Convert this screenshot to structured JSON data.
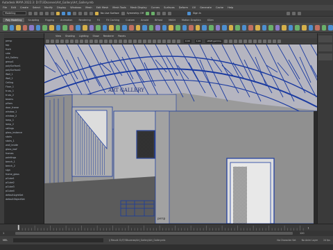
{
  "window": {
    "title": "Autodesk MAYA 2022.3: D:\\T\\3Dscenes\\Art_Gallery\\Art_Gallery.mb"
  },
  "menus": [
    "File",
    "Edit",
    "Create",
    "Select",
    "Modify",
    "Display",
    "Windows",
    "Mesh",
    "Edit Mesh",
    "Mesh Tools",
    "Mesh Display",
    "Curves",
    "Surfaces",
    "Deform",
    "UV",
    "Generate",
    "Cache",
    "Help"
  ],
  "status": {
    "mode": "Modeling",
    "live_surface": "No Live Surface",
    "symmetry": "Symmetry: Off",
    "sign_in": "Sign In"
  },
  "shelf": {
    "tabs": [
      "Poly Modeling",
      "Sculpting",
      "Rigging",
      "Animation",
      "Rendering",
      "FX",
      "FX Caching",
      "Custom",
      "Arnold",
      "Bifrost",
      "MASH",
      "Motion Graphics",
      "XGen"
    ],
    "active_tab": "Poly Modeling",
    "icon_colors": [
      "#6ab06a",
      "#4d8fd0",
      "#d6b04a",
      "#c07060",
      "#8a7ac8",
      "#4d8fd0",
      "#6ab06a",
      "#d6b04a",
      "#4d8fd0",
      "#6ab06a",
      "#c07060",
      "#4d8fd0",
      "#d6b04a",
      "#8a7ac8",
      "#6ab06a",
      "#4d8fd0",
      "#d6b04a",
      "#6ab06a",
      "#4d8fd0",
      "#c07060",
      "#d6b04a",
      "#4d8fd0",
      "#6ab06a",
      "#8a7ac8",
      "#4d8fd0",
      "#d6b04a",
      "#6ab06a",
      "#4d8fd0",
      "#c07060",
      "#d6b04a",
      "#4d8fd0",
      "#6ab06a",
      "#8a7ac8",
      "#4d8fd0",
      "#d6b04a",
      "#6ab06a",
      "#4d8fd0",
      "#c07060",
      "#d6b04a",
      "#4d8fd0",
      "#6ab06a",
      "#8a7ac8",
      "#d6b04a",
      "#4d8fd0",
      "#6ab06a",
      "#d6b04a",
      "#4d8fd0",
      "#c07060",
      "#6ab06a",
      "#4d8fd0"
    ]
  },
  "outliner": {
    "items": [
      "persp",
      "top",
      "front",
      "side",
      "Art_Gallery",
      "group1",
      "polySurface1",
      "polySurface2",
      "Wall_1",
      "Wall_2",
      "Ceiling",
      "Floor_1",
      "truss_1",
      "truss_2",
      "beams",
      "pillars",
      "door_frame",
      "window_1",
      "window_2",
      "lamp_1",
      "lamp_2",
      "railings",
      "glass_instance",
      "stairs",
      "stairs_1",
      "wall_inside",
      "glass_roof",
      "frames",
      "paintings",
      "bench_1",
      "bench_2",
      "sign",
      "frame_glass",
      "pCube1",
      "pCube2",
      "pCube3",
      "pCube4",
      "defaultLightSet",
      "defaultObjectSet"
    ]
  },
  "viewport": {
    "menus": [
      "View",
      "Shading",
      "Lighting",
      "Show",
      "Renderer",
      "Panels"
    ],
    "fields": [
      "0.00",
      "1.00"
    ],
    "colorspace": "sRGB gamma",
    "camera_label": "persp",
    "sign_text": "ART GALLERY"
  },
  "timeline": {
    "current_frame": "1",
    "start": "1",
    "end": "120",
    "no_character_set": "No Character Set",
    "no_anim_layer": "No Anim Layer",
    "fps": "24 fps",
    "mel": "MEL",
    "result": "// Result: D:/T/3Dscenes/Art_Gallery/Art_Gallery.mb"
  },
  "colors": {
    "wire": "#1a3aa0",
    "grid": "#8a8a8a",
    "floor": "#5b5b5b"
  }
}
